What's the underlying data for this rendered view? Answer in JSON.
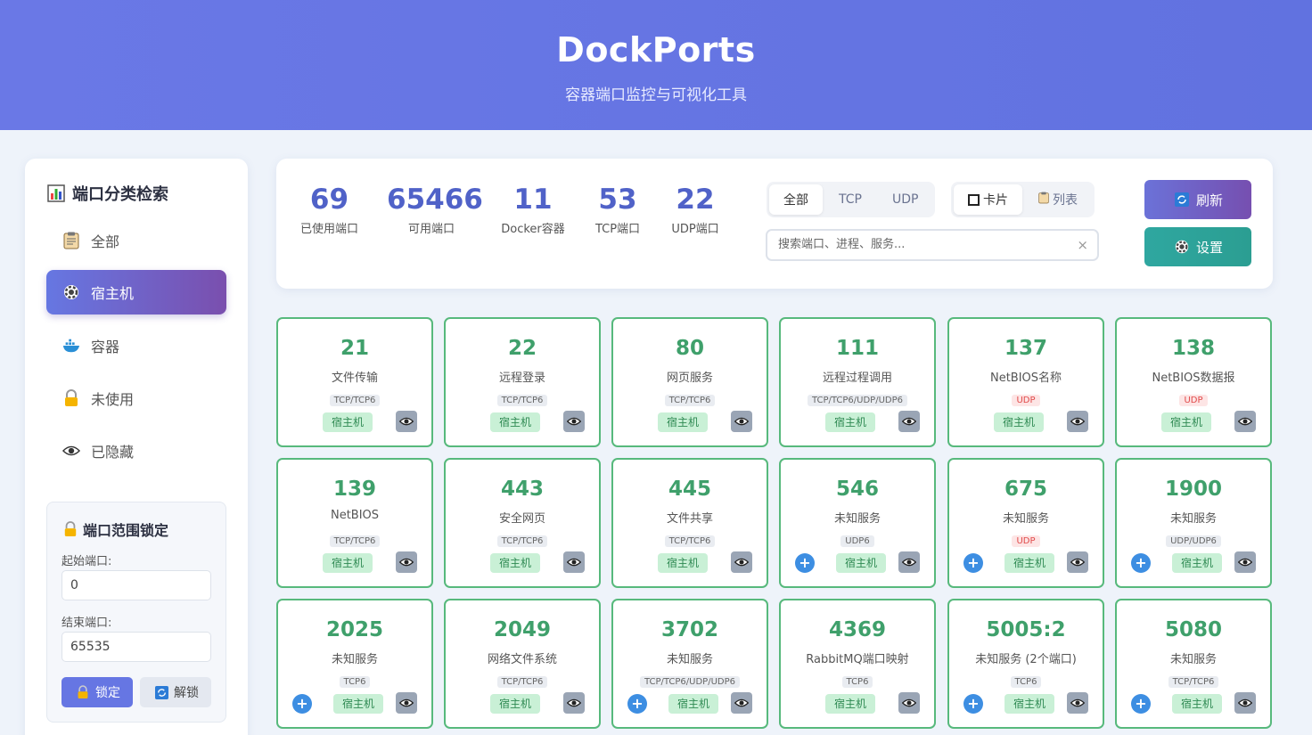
{
  "header": {
    "title": "DockPorts",
    "subtitle": "容器端口监控与可视化工具"
  },
  "sidebar": {
    "title": "端口分类检索",
    "items": [
      {
        "label": "全部",
        "icon": "clipboard-icon"
      },
      {
        "label": "宿主机",
        "icon": "gear-icon"
      },
      {
        "label": "容器",
        "icon": "docker-icon"
      },
      {
        "label": "未使用",
        "icon": "lock-icon"
      },
      {
        "label": "已隐藏",
        "icon": "eye-icon"
      }
    ],
    "lock": {
      "title": "端口范围锁定",
      "start_label": "起始端口:",
      "start_value": "0",
      "end_label": "结束端口:",
      "end_value": "65535",
      "lock_label": "锁定",
      "unlock_label": "解锁"
    }
  },
  "stats": [
    {
      "num": "69",
      "label": "已使用端口"
    },
    {
      "num": "65466",
      "label": "可用端口"
    },
    {
      "num": "11",
      "label": "Docker容器"
    },
    {
      "num": "53",
      "label": "TCP端口"
    },
    {
      "num": "22",
      "label": "UDP端口"
    }
  ],
  "filters": {
    "protocol": [
      "全部",
      "TCP",
      "UDP"
    ],
    "view": [
      "卡片",
      "列表"
    ],
    "search_placeholder": "搜索端口、进程、服务...",
    "clear": "×"
  },
  "actions": {
    "refresh": "刷新",
    "settings": "设置"
  },
  "host_tag": "宿主机",
  "cards": [
    {
      "port": "21",
      "service": "文件传输",
      "protocol": "TCP/TCP6",
      "plus": false
    },
    {
      "port": "22",
      "service": "远程登录",
      "protocol": "TCP/TCP6",
      "plus": false
    },
    {
      "port": "80",
      "service": "网页服务",
      "protocol": "TCP/TCP6",
      "plus": false
    },
    {
      "port": "111",
      "service": "远程过程调用",
      "protocol": "TCP/TCP6/UDP/UDP6",
      "plus": false
    },
    {
      "port": "137",
      "service": "NetBIOS名称",
      "protocol": "UDP",
      "plus": false
    },
    {
      "port": "138",
      "service": "NetBIOS数据报",
      "protocol": "UDP",
      "plus": false
    },
    {
      "port": "139",
      "service": "NetBIOS",
      "protocol": "TCP/TCP6",
      "plus": false
    },
    {
      "port": "443",
      "service": "安全网页",
      "protocol": "TCP/TCP6",
      "plus": false
    },
    {
      "port": "445",
      "service": "文件共享",
      "protocol": "TCP/TCP6",
      "plus": false
    },
    {
      "port": "546",
      "service": "未知服务",
      "protocol": "UDP6",
      "plus": true
    },
    {
      "port": "675",
      "service": "未知服务",
      "protocol": "UDP",
      "plus": true
    },
    {
      "port": "1900",
      "service": "未知服务",
      "protocol": "UDP/UDP6",
      "plus": true
    },
    {
      "port": "2025",
      "service": "未知服务",
      "protocol": "TCP6",
      "plus": true
    },
    {
      "port": "2049",
      "service": "网络文件系统",
      "protocol": "TCP/TCP6",
      "plus": false
    },
    {
      "port": "3702",
      "service": "未知服务",
      "protocol": "TCP/TCP6/UDP/UDP6",
      "plus": true
    },
    {
      "port": "4369",
      "service": "RabbitMQ端口映射",
      "protocol": "TCP6",
      "plus": false
    },
    {
      "port": "5005:2",
      "service": "未知服务 (2个端口)",
      "protocol": "TCP6",
      "plus": true
    },
    {
      "port": "5080",
      "service": "未知服务",
      "protocol": "TCP/TCP6",
      "plus": true
    }
  ],
  "colors": {
    "header": "#6172e0",
    "accent": "#5062c8",
    "card_border": "#57b97c",
    "port_text": "#3fa06b",
    "udp": "#e14a4a"
  }
}
